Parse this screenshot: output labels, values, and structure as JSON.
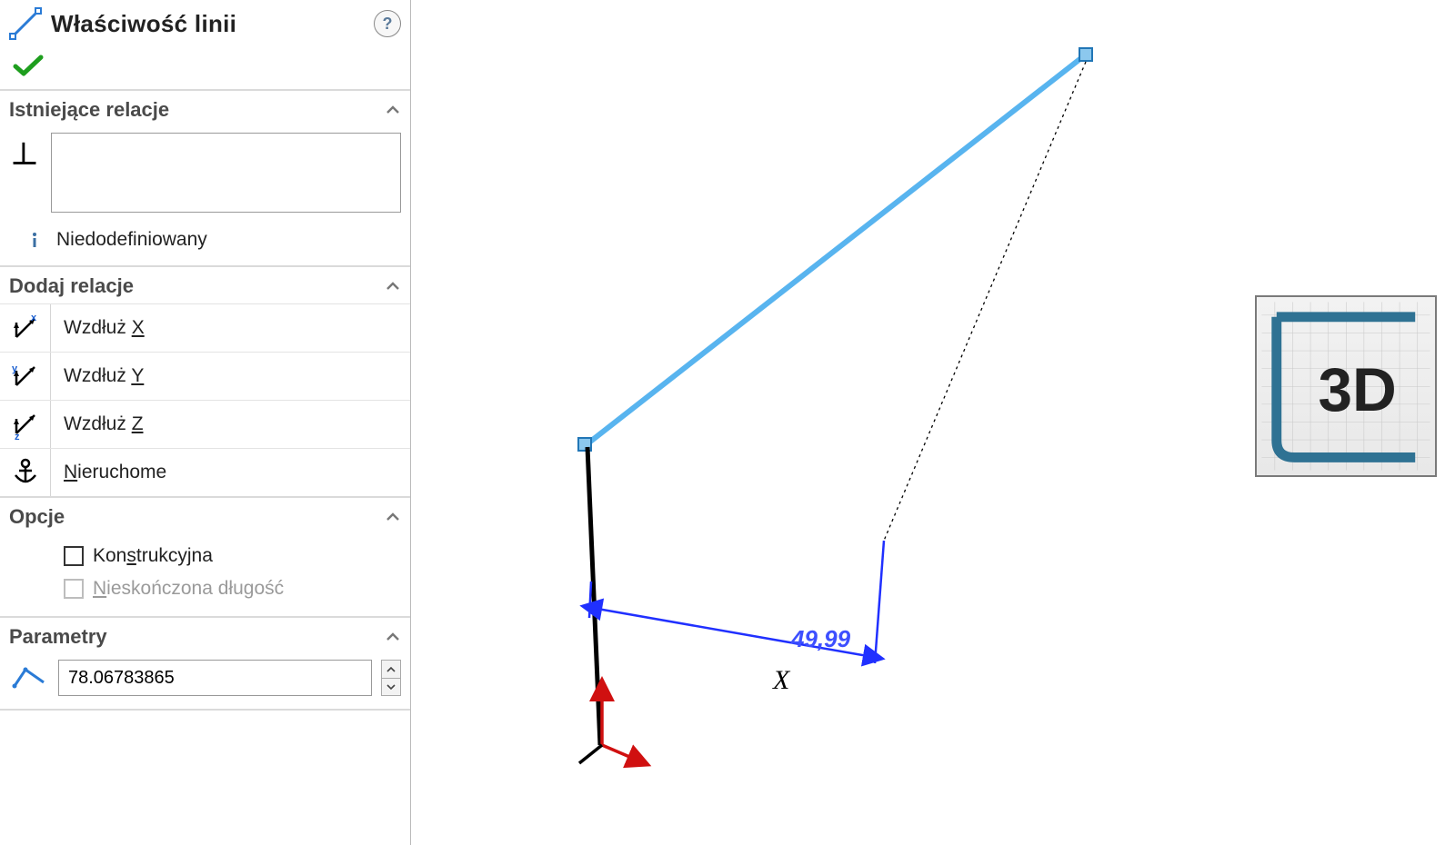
{
  "panel": {
    "title": "Właściwość linii"
  },
  "existing_relations": {
    "title": "Istniejące relacje",
    "status": "Niedodefiniowany"
  },
  "add_relations": {
    "title": "Dodaj relacje",
    "items": [
      {
        "label_prefix": "Wzdłuż ",
        "hotkey": "X"
      },
      {
        "label_prefix": "Wzdłuż ",
        "hotkey": "Y"
      },
      {
        "label_prefix": "Wzdłuż ",
        "hotkey": "Z"
      },
      {
        "label_prefix": "",
        "hotkey": "N",
        "label_suffix": "ieruchome"
      }
    ]
  },
  "options": {
    "title": "Opcje",
    "construction_prefix": "Kon",
    "construction_hotkey": "s",
    "construction_suffix": "trukcyjna",
    "infinite_prefix": "",
    "infinite_hotkey": "N",
    "infinite_suffix": "ieskończona długość"
  },
  "parameters": {
    "title": "Parametry",
    "value": "78.06783865"
  },
  "viewport": {
    "dimension_label": "49,99",
    "axis_label": "X",
    "badge": "3D"
  }
}
